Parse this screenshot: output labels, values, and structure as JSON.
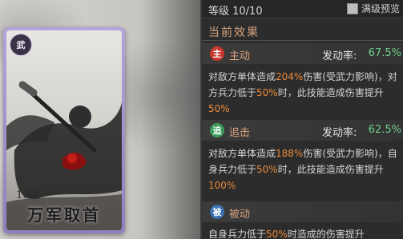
{
  "card": {
    "type_label": "武",
    "level": "10级",
    "name": "万军取首"
  },
  "header": {
    "level_text": "等级 10/10",
    "preview_label": "满级预览",
    "preview_checked": false
  },
  "section": {
    "title": "当前效果"
  },
  "effects": [
    {
      "icon_char": "主",
      "icon_color": "#c8372d",
      "name": "主动",
      "rate_label": "发动率:",
      "rate_value": "67.5%",
      "desc": {
        "p1": "对敌方单体造成",
        "v1": "204%",
        "p2": "伤害(受武力影响)，对方兵力低于",
        "v2": "50%",
        "p3": "时，此技能造成伤害提升",
        "v3": "50%",
        "p4": ""
      }
    },
    {
      "icon_char": "追",
      "icon_color": "#3a9a5a",
      "name": "追击",
      "rate_label": "发动率:",
      "rate_value": "62.5%",
      "desc": {
        "p1": "对敌方单体造成",
        "v1": "188%",
        "p2": "伤害(受武力影响)，自身兵力低于",
        "v2": "50%",
        "p3": "时，此技能造成伤害提升",
        "v3": "100%",
        "p4": ""
      }
    },
    {
      "icon_char": "被",
      "icon_color": "#3a6fb0",
      "name": "被动",
      "desc": {
        "p1": "自身兵力低于",
        "v1": "50%",
        "p2": "时造成的伤害提升"
      }
    }
  ],
  "colors": {
    "accent": "#d9a47c",
    "highlight": "#e88a3b",
    "rate": "#6fcf8a",
    "card_frame": "#9d8ecb"
  }
}
